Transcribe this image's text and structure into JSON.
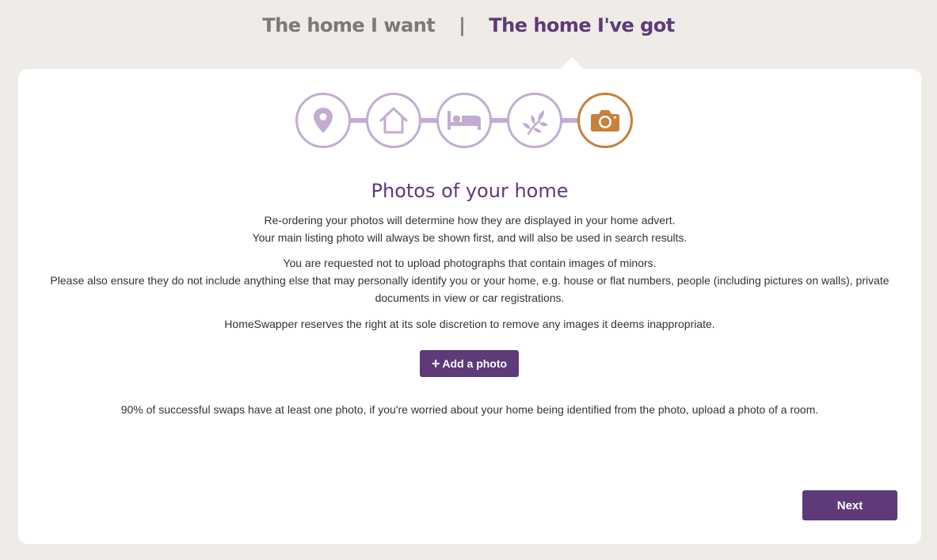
{
  "tabs": {
    "home_i_want": "The home I want",
    "separator": "|",
    "home_ive_got": "The home I've got"
  },
  "steps": [
    {
      "icon": "location-pin-icon",
      "state": "done"
    },
    {
      "icon": "house-icon",
      "state": "done"
    },
    {
      "icon": "bed-icon",
      "state": "done"
    },
    {
      "icon": "leaf-icon",
      "state": "done"
    },
    {
      "icon": "camera-icon",
      "state": "active"
    }
  ],
  "colors": {
    "brand_purple": "#5e3a78",
    "step_inactive": "#c3acd3",
    "step_active": "#c8803a",
    "background": "#efebe7"
  },
  "content": {
    "title": "Photos of your home",
    "intro_line1": "Re-ordering your photos will determine how they are displayed in your home advert.",
    "intro_line2": "Your main listing photo will always be shown first, and will also be used in search results.",
    "minors_line": "You are requested not to upload photographs that contain images of minors.",
    "privacy_line": "Please also ensure they do not include anything else that may personally identify you or your home, e.g. house or flat numbers, people (including pictures on walls), private documents in view or car registrations.",
    "rights_line": "HomeSwapper reserves the right at its sole discretion to remove any images it deems inappropriate.",
    "add_photo_label": "Add a photo",
    "add_photo_plus": "+",
    "stats_line": "90% of successful swaps have at least one photo, if you're worried about your home being identified from the photo, upload a photo of a room."
  },
  "footer": {
    "next_label": "Next"
  }
}
